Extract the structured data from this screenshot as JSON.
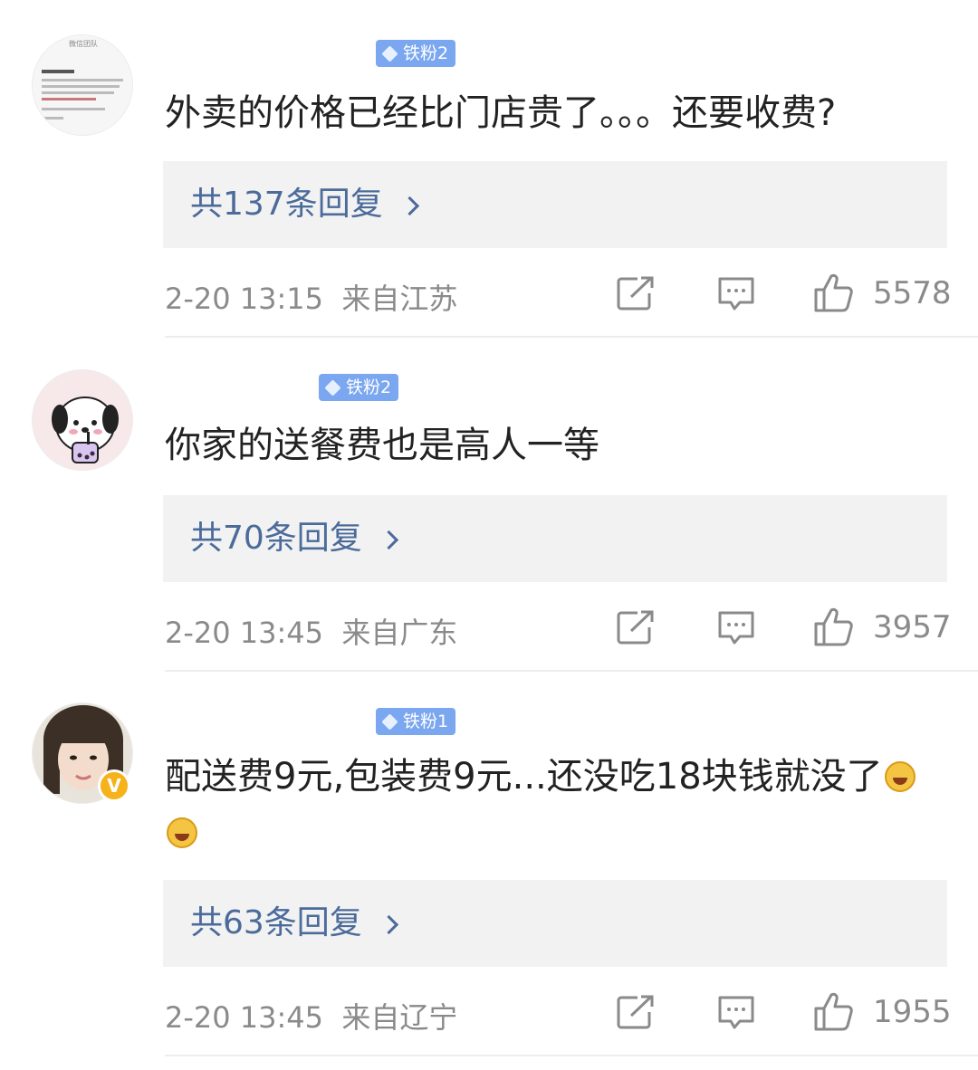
{
  "comments": [
    {
      "badge": "铁粉2",
      "text": "外卖的价格已经比门店贵了。。。还要收费?",
      "replies": "共137条回复",
      "date": "2-20 13:15",
      "location": "来自江苏",
      "likes": "5578",
      "avatar_icon": "document-screenshot-avatar-icon",
      "avatar_caption": "微信团队"
    },
    {
      "badge": "铁粉2",
      "text": "你家的送餐费也是高人一等",
      "replies": "共70条回复",
      "date": "2-20 13:45",
      "location": "来自广东",
      "likes": "3957",
      "avatar_icon": "cartoon-dog-avatar-icon"
    },
    {
      "badge": "铁粉1",
      "text": "配送费9元,包装费9元...还没吃18块钱就没了",
      "replies": "共63条回复",
      "date": "2-20 13:45",
      "location": "来自辽宁",
      "likes": "1955",
      "avatar_icon": "person-photo-avatar-icon",
      "verified": "V",
      "emojis": [
        "laugh-cry-emoji",
        "laugh-cry-emoji"
      ]
    }
  ],
  "colors": {
    "badge_bg": "#7aa7ef",
    "reply_link": "#4b6b9b",
    "meta_text": "#8a8a8a",
    "reply_box_bg": "#f2f2f2"
  }
}
